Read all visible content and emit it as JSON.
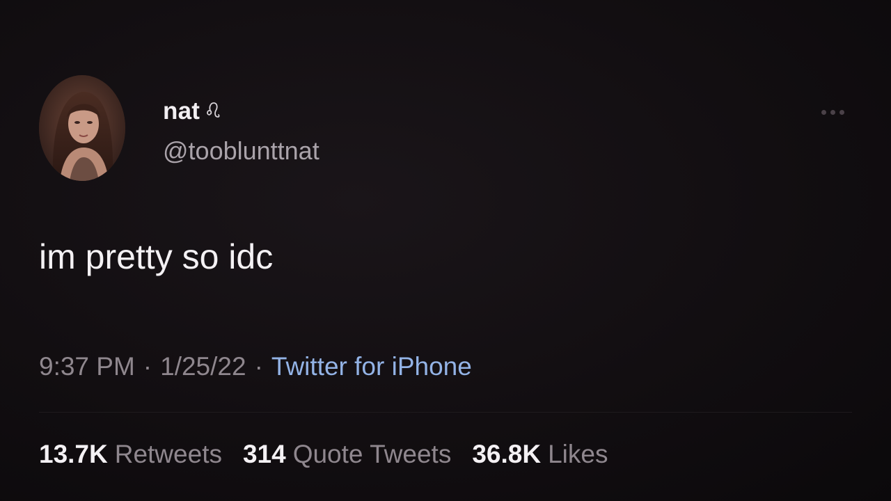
{
  "author": {
    "display_name": "nat",
    "zodiac_icon": "leo-icon",
    "handle": "@tooblunttnat"
  },
  "tweet": {
    "text": "im pretty so idc",
    "time": "9:37 PM",
    "date": "1/25/22",
    "separator": "·",
    "source": "Twitter for iPhone"
  },
  "stats": {
    "retweets": {
      "count": "13.7K",
      "label": "Retweets"
    },
    "quotes": {
      "count": "314",
      "label": "Quote Tweets"
    },
    "likes": {
      "count": "36.8K",
      "label": "Likes"
    }
  },
  "icons": {
    "more": "more-options-icon"
  },
  "colors": {
    "background": "#120e11",
    "link": "#93b3e6",
    "secondary_text": "#8f878e"
  }
}
